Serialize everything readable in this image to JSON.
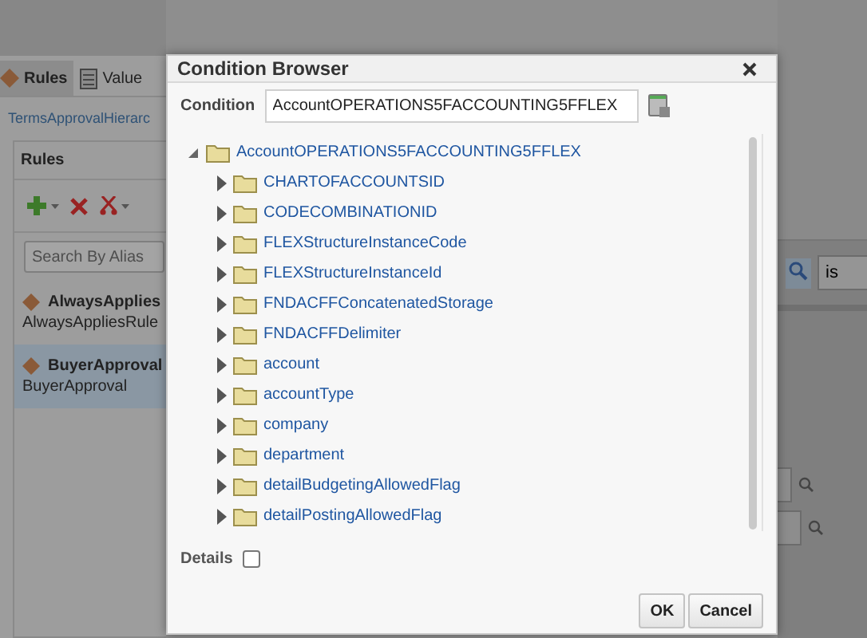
{
  "background": {
    "tabs": [
      {
        "label": "Rules",
        "selected": true
      },
      {
        "label": "Value",
        "selected": false
      }
    ],
    "breadcrumb": "TermsApprovalHierarc",
    "rules_panel": {
      "title": "Rules",
      "search": {
        "placeholder": "Search By Alias"
      },
      "items": [
        {
          "name": "AlwaysApplies",
          "alias": "AlwaysAppliesRule",
          "selected": false
        },
        {
          "name": "BuyerApproval",
          "alias": "BuyerApproval",
          "selected": true
        }
      ]
    },
    "operator_field": {
      "value": "is"
    }
  },
  "dialog": {
    "title": "Condition Browser",
    "condition": {
      "label": "Condition",
      "value": "AccountOPERATIONS5FACCOUNTING5FFLEX"
    },
    "tree": {
      "label": "AccountOPERATIONS5FACCOUNTING5FFLEX",
      "expanded": true,
      "children": [
        {
          "label": "CHARTOFACCOUNTSID",
          "expanded": false
        },
        {
          "label": "CODECOMBINATIONID",
          "expanded": false
        },
        {
          "label": "FLEXStructureInstanceCode",
          "expanded": false
        },
        {
          "label": "FLEXStructureInstanceId",
          "expanded": false
        },
        {
          "label": "FNDACFFConcatenatedStorage",
          "expanded": false
        },
        {
          "label": "FNDACFFDelimiter",
          "expanded": false
        },
        {
          "label": "account",
          "expanded": false
        },
        {
          "label": "accountType",
          "expanded": false
        },
        {
          "label": "company",
          "expanded": false
        },
        {
          "label": "department",
          "expanded": false
        },
        {
          "label": "detailBudgetingAllowedFlag",
          "expanded": false
        },
        {
          "label": "detailPostingAllowedFlag",
          "expanded": false
        }
      ]
    },
    "details": {
      "label": "Details",
      "checked": false
    },
    "buttons": [
      "OK",
      "Cancel"
    ]
  }
}
